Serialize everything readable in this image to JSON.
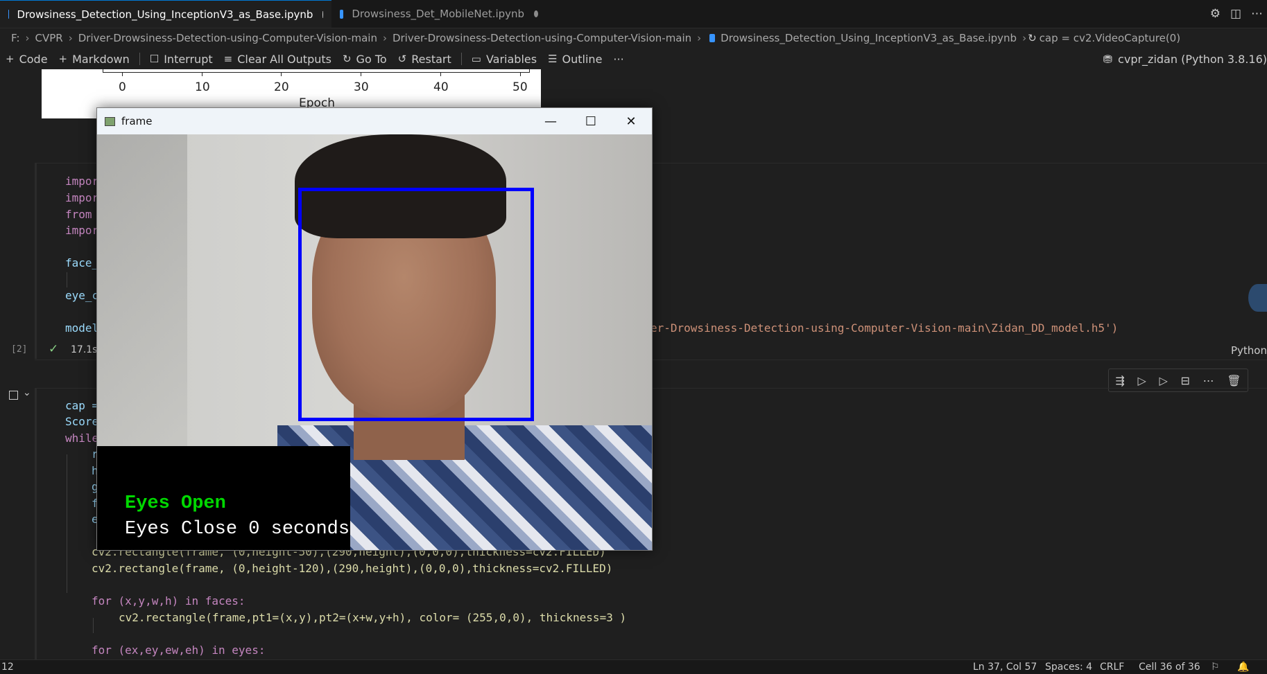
{
  "tabs": [
    {
      "label": "Drowsiness_Detection_Using_InceptionV3_as_Base.ipynb",
      "active": true,
      "dirty": true
    },
    {
      "label": "Drowsiness_Det_MobileNet.ipynb",
      "active": false,
      "dirty": true
    }
  ],
  "tab_actions": {
    "settings_icon": "gear-icon",
    "split_icon": "split-editor-icon",
    "more_icon": "more-icon"
  },
  "breadcrumb": {
    "drive": "F:",
    "parts": [
      "CVPR",
      "Driver-Drowsiness-Detection-using-Computer-Vision-main",
      "Driver-Drowsiness-Detection-using-Computer-Vision-main"
    ],
    "file": "Drowsiness_Detection_Using_InceptionV3_as_Base.ipynb",
    "symbol": "cap = cv2.VideoCapture(0)"
  },
  "toolbar": {
    "code": "Code",
    "markdown": "Markdown",
    "interrupt": "Interrupt",
    "clear_all_outputs": "Clear All Outputs",
    "go_to": "Go To",
    "restart": "Restart",
    "variables": "Variables",
    "outline": "Outline",
    "more": "···"
  },
  "kernel": {
    "label": "cvpr_zidan (Python 3.8.16)"
  },
  "plot_output": {
    "ticks": [
      "0",
      "10",
      "20",
      "30",
      "40",
      "50"
    ],
    "xlabel": "Epoch"
  },
  "cell1": {
    "lines": [
      "impor",
      "impor",
      "from ",
      "impor",
      "",
      "face_",
      "",
      "eye_c",
      "",
      "model"
    ],
    "model_path_tail": "er-Drowsiness-Detection-using-Computer-Vision-main\\Zidan_DD_model.h5')",
    "exec_count": "[2]",
    "exec_time": "17.1s",
    "language": "Python"
  },
  "cell2": {
    "line_cap": "cap =",
    "line_score": "Score",
    "line_while": "while",
    "partial_chars": [
      "r",
      "h",
      "g",
      "f",
      "e"
    ],
    "rect1": "cv2.rectangle(frame, (0,height-50),(290,height),(0,0,0),thickness=cv2.FILLED)",
    "rect2": "cv2.rectangle(frame, (0,height-120),(290,height),(0,0,0),thickness=cv2.FILLED)",
    "for_faces": "for (x,y,w,h) in faces:",
    "rect_face": "cv2.rectangle(frame,pt1=(x,y),pt2=(x+w,y+h), color= (255,0,0), thickness=3 )",
    "for_eyes": "for (ex,ey,ew,eh) in eyes:"
  },
  "frame_window": {
    "title": "frame",
    "eyes_open": "Eyes Open",
    "eyes_close": "Eyes Close 0 seconds"
  },
  "statusbar": {
    "left": "12",
    "position": "Ln 37, Col 57",
    "spaces": "Spaces: 4",
    "eol": "CRLF",
    "cell": "Cell 36 of 36"
  }
}
